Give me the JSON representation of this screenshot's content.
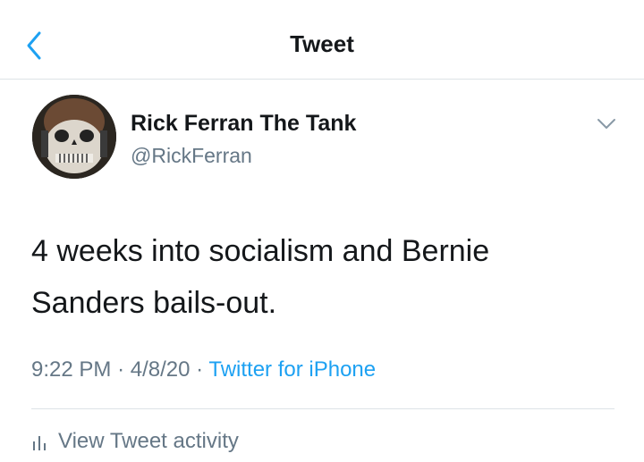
{
  "header": {
    "title": "Tweet"
  },
  "tweet": {
    "author_name": "Rick Ferran The Tank",
    "author_handle": "@RickFerran",
    "text_line1": "4 weeks into socialism and Bernie",
    "text_line2": "Sanders bails-out.",
    "time": "9:22 PM",
    "date": "4/8/20",
    "source": "Twitter for iPhone",
    "separator": "·"
  },
  "actions": {
    "activity_label": "View Tweet activity"
  },
  "colors": {
    "accent": "#1da1f2",
    "muted": "#657786",
    "text": "#14171a",
    "divider": "#dde2e6"
  },
  "icons": {
    "back": "chevron-left-icon",
    "menu": "chevron-down-icon",
    "activity": "bar-chart-icon"
  }
}
